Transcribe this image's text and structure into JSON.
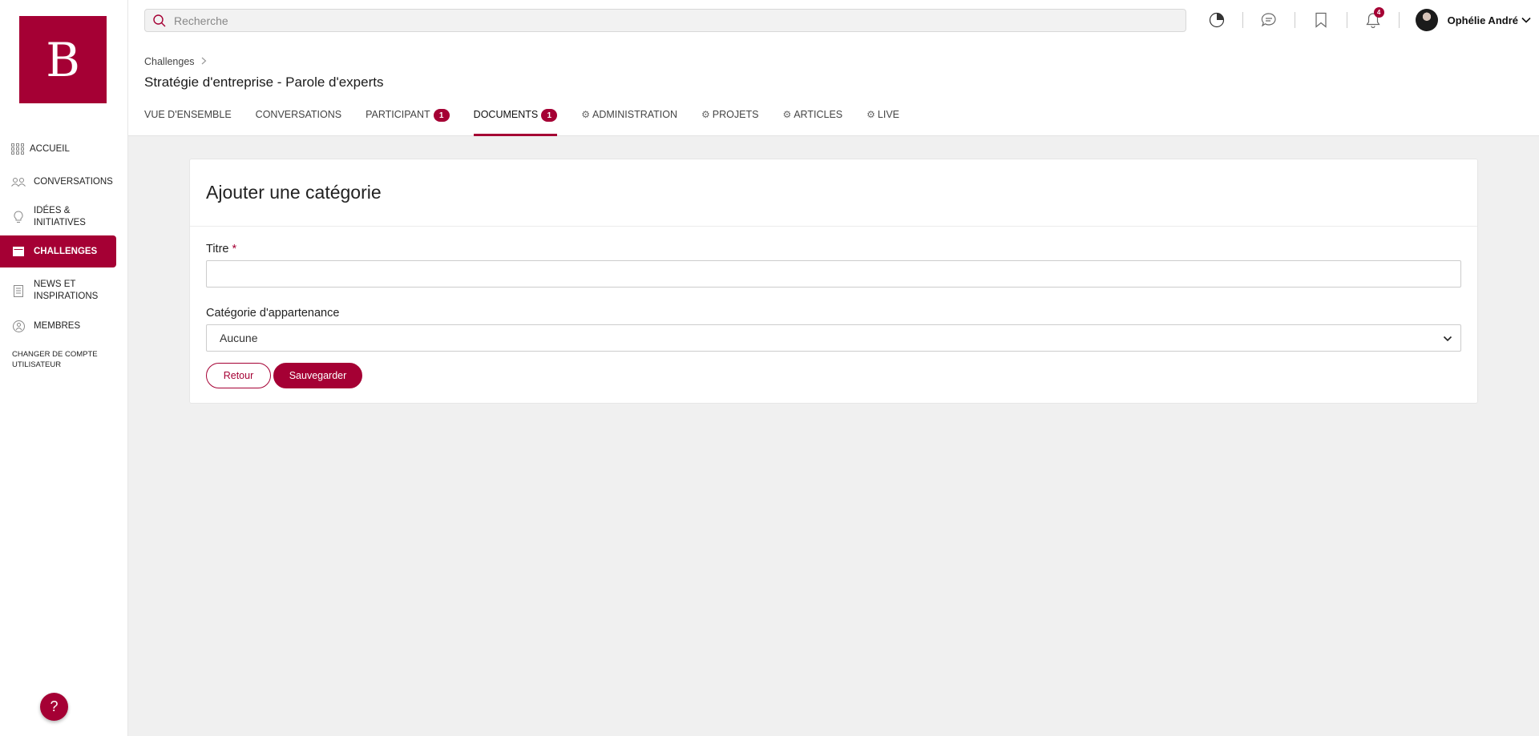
{
  "brand": {
    "logo_letter": "B",
    "accent": "#a50034"
  },
  "sidebar": {
    "items": [
      {
        "label": "ACCUEIL",
        "icon": "grid-icon"
      },
      {
        "label": "CONVERSATIONS",
        "icon": "people-icon"
      },
      {
        "label": "IDÉES & INITIATIVES",
        "icon": "lightbulb-icon"
      },
      {
        "label": "CHALLENGES",
        "icon": "calendar-icon",
        "active": true
      },
      {
        "label": "NEWS ET INSPIRATIONS",
        "icon": "document-icon"
      },
      {
        "label": "MEMBRES",
        "icon": "members-icon"
      }
    ],
    "switch_account": "CHANGER DE COMPTE UTILISATEUR",
    "help": "?"
  },
  "search": {
    "placeholder": "Recherche"
  },
  "topbar": {
    "notification_count": "4",
    "user_name": "Ophélie André"
  },
  "breadcrumb": {
    "root": "Challenges"
  },
  "page": {
    "title": "Stratégie d'entreprise - Parole d'experts"
  },
  "tabs": [
    {
      "label": "VUE D'ENSEMBLE"
    },
    {
      "label": "CONVERSATIONS"
    },
    {
      "label": "PARTICIPANT",
      "badge": "1"
    },
    {
      "label": "DOCUMENTS",
      "badge": "1",
      "active": true
    },
    {
      "label": "ADMINISTRATION",
      "gear": true
    },
    {
      "label": "PROJETS",
      "gear": true
    },
    {
      "label": "ARTICLES",
      "gear": true
    },
    {
      "label": "LIVE",
      "gear": true
    }
  ],
  "form": {
    "heading": "Ajouter une catégorie",
    "title_label": "Titre",
    "required_mark": "*",
    "title_value": "",
    "parent_label": "Catégorie d'appartenance",
    "parent_selected": "Aucune",
    "back_label": "Retour",
    "save_label": "Sauvegarder"
  }
}
